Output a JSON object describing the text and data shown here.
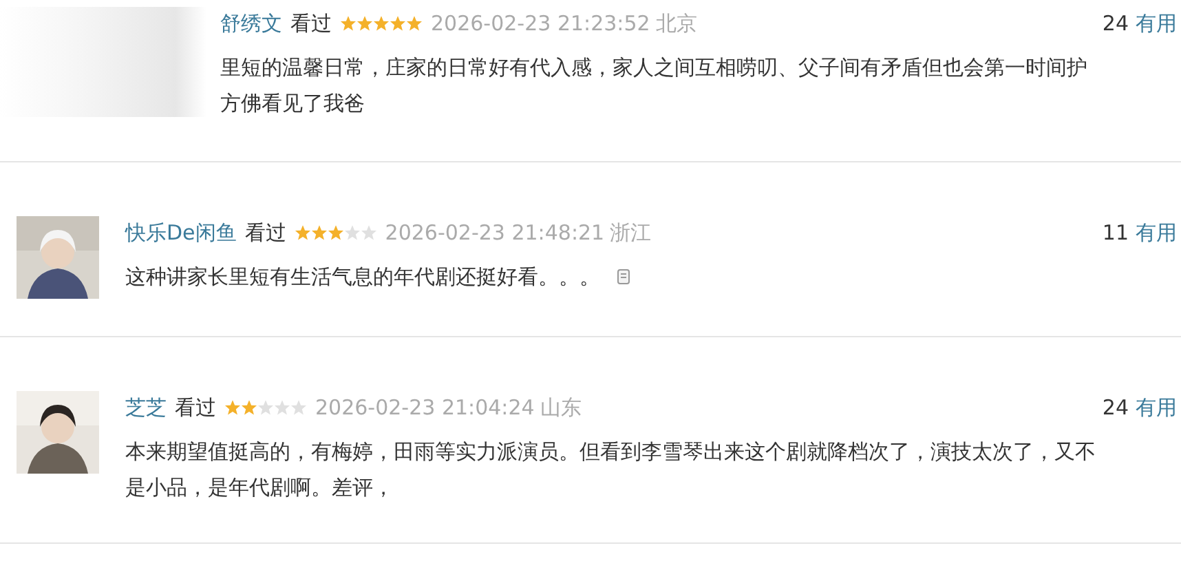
{
  "reviews": [
    {
      "kind": "blurred",
      "user": "舒绣文",
      "status": "看过",
      "stars": 5,
      "time": "2026-02-23 21:23:52",
      "location": "北京",
      "useful_count": "24",
      "useful_label": "有用",
      "lines": [
        "里短的温馨日常，庄家的日常好有代入感，家人之间互相唠叨、父子间有矛盾但也会第一时间护",
        "方佛看见了我爸"
      ],
      "note_icon": false
    },
    {
      "kind": "avatar",
      "user": "快乐De闲鱼",
      "status": "看过",
      "stars": 3,
      "time": "2026-02-23 21:48:21",
      "location": "浙江",
      "useful_count": "11",
      "useful_label": "有用",
      "lines": [
        "这种讲家长里短有生活气息的年代剧还挺好看。。。"
      ],
      "note_icon": true
    },
    {
      "kind": "avatar",
      "user": "芝芝",
      "status": "看过",
      "stars": 2,
      "time": "2026-02-23 21:04:24",
      "location": "山东",
      "useful_count": "24",
      "useful_label": "有用",
      "lines": [
        "本来期望值挺高的，有梅婷，田雨等实力派演员。但看到李雪琴出来这个剧就降档次了，演技太次了，又不",
        "是小品，是年代剧啊。差评，"
      ],
      "note_icon": false
    }
  ]
}
